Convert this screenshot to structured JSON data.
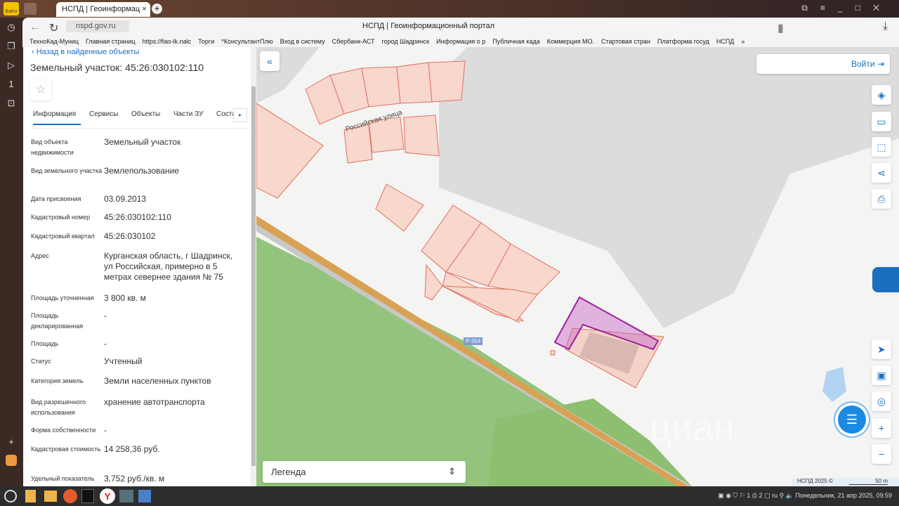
{
  "browser": {
    "profile_label": "Войти",
    "tab_title": "НСПД | Геоинформац",
    "url": "nspd.gov.ru",
    "page_title": "НСПД | Геоинформационный портал",
    "bookmarks": [
      "ТехноКад-Муниц",
      "Главная страниц",
      "https://fias-lk.nalc",
      "Торги",
      "*КонсультантПлю",
      "Вход в систему",
      "Сбербанк-АСТ",
      "город Шадринск",
      "Информация о р",
      "Публичная када",
      "Коммерция МО.",
      "Стартовая стран",
      "Платформа госуд",
      "НСПД",
      "»"
    ]
  },
  "panel": {
    "back_link": "Назад в найденные объекты",
    "title": "Земельный участок: 45:26:030102:110",
    "tabs": [
      "Информация",
      "Сервисы",
      "Объекты",
      "Части ЗУ",
      "Соста"
    ],
    "fields": [
      {
        "label": "Вид объекта недвижимости",
        "value": "Земельный участок"
      },
      {
        "label": "Вид земельного участка",
        "value": "Землепользование"
      },
      {
        "label": "Дата присвоения",
        "value": "03.09.2013"
      },
      {
        "label": "Кадастровый номер",
        "value": "45:26:030102:110"
      },
      {
        "label": "Кадастровый квартал",
        "value": "45:26:030102"
      },
      {
        "label": "Адрес",
        "value": "Курганская область, г Шадринск, ул Российская, примерно в 5 метрах севернее здания № 75"
      },
      {
        "label": "Площадь уточненная",
        "value": "3 800 кв. м"
      },
      {
        "label": "Площадь декларированная",
        "value": "-"
      },
      {
        "label": "Площадь",
        "value": "-"
      },
      {
        "label": "Статус",
        "value": "Учтенный"
      },
      {
        "label": "Категория земель",
        "value": "Земли населенных пунктов"
      },
      {
        "label": "Вид разрешенного использования",
        "value": "хранение автотранспорта"
      },
      {
        "label": "Форма собственности",
        "value": "-"
      },
      {
        "label": "Кадастровая стоимость",
        "value": "14 258,36 руб."
      },
      {
        "label": "Удельный показатель",
        "value": "3,752 руб./кв. м"
      }
    ]
  },
  "map": {
    "login_label": "Войти",
    "street_label": "Российская улица",
    "road_label": "Р-354",
    "legend_label": "Легенда",
    "attribution": "НСПД 2025 ©",
    "scale": "50 m",
    "watermark": "циан"
  },
  "taskbar": {
    "lang": "ru",
    "clock": "Понедельник, 21 апр 2025, 09:59",
    "ws1": "1",
    "ws2": "2"
  }
}
